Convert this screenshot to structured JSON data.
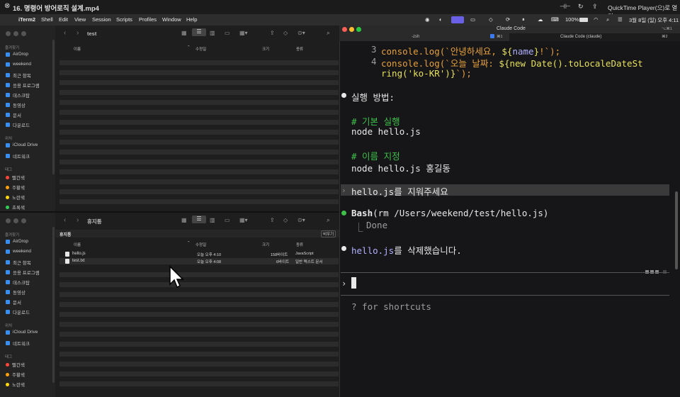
{
  "window_title": "16. 명령어 방어로직 설계.mp4",
  "quicktime_open": "QuickTime Player(으)로 열기",
  "menubar": {
    "app": "iTerm2",
    "items": [
      "Shell",
      "Edit",
      "View",
      "Session",
      "Scripts",
      "Profiles",
      "Window",
      "Help"
    ],
    "battery": "100%",
    "clock": "3월 8일 (일) 오후 4:11"
  },
  "finder_top": {
    "folder": "test",
    "favorites_header": "즐겨찾기",
    "favorites": [
      "AirDrop",
      "weekend",
      "최근 항목",
      "응용 프로그램",
      "데스크탑",
      "동영상",
      "문서",
      "다운로드"
    ],
    "locations_header": "위치",
    "locations": [
      "iCloud Drive",
      "네트워크"
    ],
    "tags_header": "태그",
    "tags": [
      {
        "label": "빨간색",
        "color": "#ff453a"
      },
      {
        "label": "주황색",
        "color": "#ff9f0a"
      },
      {
        "label": "노란색",
        "color": "#ffd60a"
      },
      {
        "label": "초록색",
        "color": "#30d158"
      }
    ],
    "columns": {
      "name": "이름",
      "modified": "수정일",
      "size": "크기",
      "kind": "종류"
    }
  },
  "finder_bottom": {
    "folder": "휴지통",
    "trash_label": "휴지통",
    "empty_button": "비우기",
    "favorites_header": "즐겨찾기",
    "favorites": [
      "AirDrop",
      "weekend",
      "최근 항목",
      "응용 프로그램",
      "데스크탑",
      "동영상",
      "문서",
      "다운로드"
    ],
    "locations_header": "위치",
    "locations": [
      "iCloud Drive",
      "네트워크"
    ],
    "tags_header": "태그",
    "tags": [
      {
        "label": "빨간색",
        "color": "#ff453a"
      },
      {
        "label": "주황색",
        "color": "#ff9f0a"
      },
      {
        "label": "노란색",
        "color": "#ffd60a"
      }
    ],
    "columns": {
      "name": "이름",
      "modified": "수정일",
      "size": "크기",
      "kind": "종류"
    },
    "files": [
      {
        "name": "hello.js",
        "modified": "오늘 오후 4:10",
        "size": "158바이트",
        "kind": "JavaScript"
      },
      {
        "name": "test.txt",
        "modified": "오늘 오후 4:08",
        "size": "6바이트",
        "kind": "일반 텍스트 문서"
      }
    ]
  },
  "terminal": {
    "title": "Claude Code",
    "shortcut": "⌥⌘1",
    "tab1": "-zsh",
    "tab1_key": "⌘1",
    "tab2": "Claude Code (claude)",
    "tab2_key": "⌘2",
    "code": [
      {
        "num": "3",
        "segments": [
          [
            "console.log(`안녕하세요, ",
            "orange"
          ],
          [
            "${",
            "yellow"
          ],
          [
            "name",
            "lav"
          ],
          [
            "}",
            "yellow"
          ],
          [
            "!`);",
            "orange"
          ]
        ]
      },
      {
        "num": "4",
        "segments": [
          [
            "console.log(`오늘 날짜: ",
            "orange"
          ],
          [
            "${new Date().toLocaleDateSt",
            "yellow"
          ]
        ]
      },
      {
        "num": "",
        "segments": [
          [
            "ring('ko-KR')}",
            "yellow"
          ],
          [
            "`);",
            "orange"
          ]
        ]
      }
    ],
    "run_header": "실행 방법:",
    "comment1": "# 기본 실행",
    "cmd1": "node hello.js",
    "comment2": "# 이름 지정",
    "cmd2": "node hello.js 홍길동",
    "user_prompt": "hello.js를 지워주세요",
    "tool_name": "Bash",
    "tool_args": "(rm /Users/weekend/test/hello.js)",
    "tool_result": "Done",
    "reply_file": "hello.js",
    "reply_rest": "를 삭제했습니다.",
    "hint": "? for shortcuts"
  }
}
